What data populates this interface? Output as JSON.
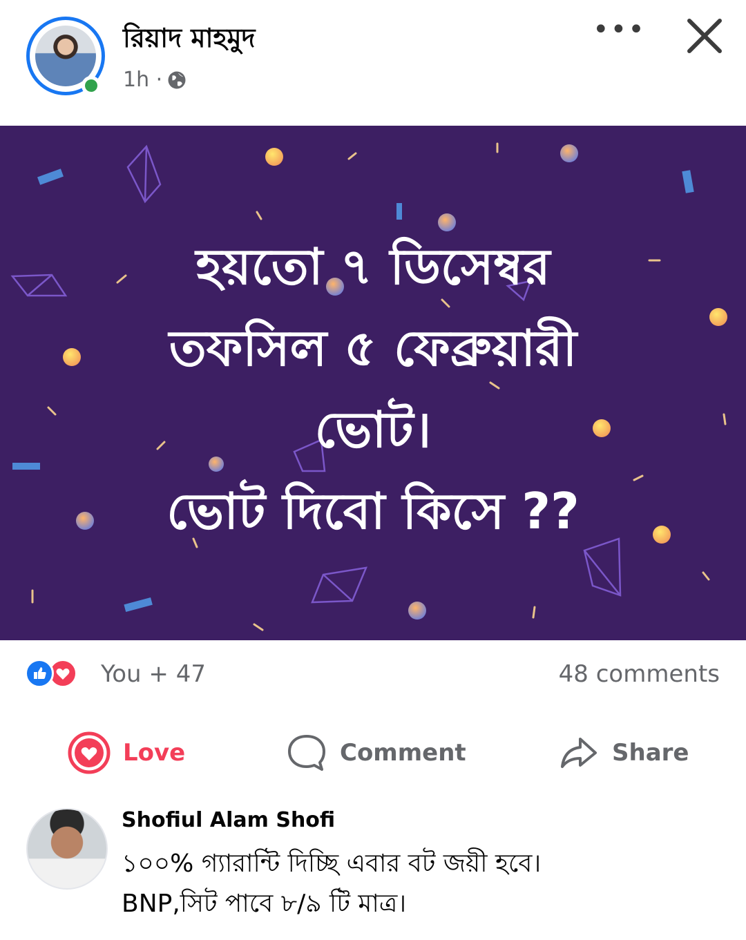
{
  "post": {
    "author": "রিয়াদ মাহমুদ",
    "time": "1h ·",
    "image_text": {
      "line1": "হয়তো ৭ ডিসেম্বর",
      "line2": "তফসিল ৫ ফেব্রুয়ারী",
      "line3": "ভোট।",
      "line4": "ভোট দিবো কিসে ??"
    },
    "image_background_color": "#3d1f63"
  },
  "reactions": {
    "summary": "You + 47",
    "comments": "48 comments"
  },
  "actions": {
    "love": "Love",
    "comment": "Comment",
    "share": "Share"
  },
  "comment": {
    "author": "Shofiul Alam Shofi",
    "line1": "১০০% গ্যারান্টি দিচ্ছি এবার বট জয়ী হবে।",
    "line2": "BNP,সিট পাবে ৮/৯ টি মাত্র।"
  },
  "colors": {
    "accent": "#1877f2",
    "love": "#f33e58",
    "online": "#31a24c",
    "muted_text": "#65676b"
  },
  "icons": [
    "more-icon",
    "close-icon",
    "globe-icon",
    "like-icon",
    "love-icon",
    "heart-icon",
    "comment-icon",
    "share-icon"
  ]
}
